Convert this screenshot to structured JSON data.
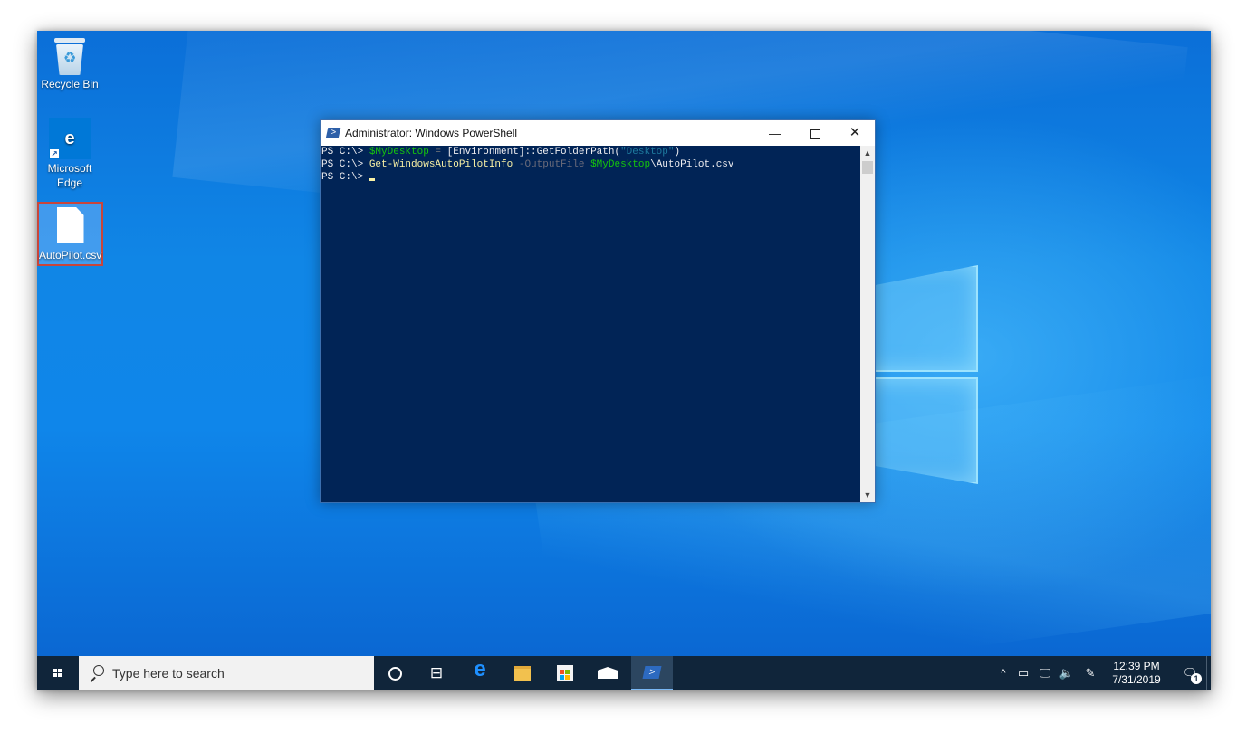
{
  "desktop": {
    "icons": [
      {
        "label": "Recycle Bin",
        "icon": "recycle-bin-icon"
      },
      {
        "label": "Microsoft Edge",
        "icon": "edge-icon"
      },
      {
        "label": "AutoPilot.csv",
        "icon": "csv-file-icon",
        "selected": true
      }
    ]
  },
  "window": {
    "title": "Administrator: Windows PowerShell",
    "icon": "powershell-icon",
    "controls": {
      "minimize": "—",
      "close": "✕"
    },
    "console": {
      "line1": {
        "prompt": "PS C:\\> ",
        "var": "$MyDesktop",
        "op": " = ",
        "class": "[Environment]::GetFolderPath(",
        "str": "\"Desktop\"",
        "close": ")"
      },
      "line2": {
        "prompt": "PS C:\\> ",
        "cmd": "Get-WindowsAutoPilotInfo",
        "param": " -OutputFile ",
        "var": "$MyDesktop",
        "path": "\\AutoPilot.csv"
      },
      "line3": {
        "prompt": "PS C:\\> "
      }
    },
    "scroll": {
      "up": "▲",
      "down": "▼"
    },
    "colors": {
      "background": "#012456",
      "variable": "#16c60c",
      "command": "#f9f1a5"
    }
  },
  "taskbar": {
    "search_placeholder": "Type here to search",
    "apps": [
      "cortana-icon",
      "task-view-icon",
      "edge-icon",
      "file-explorer-icon",
      "store-icon",
      "mail-icon",
      "powershell-icon"
    ],
    "tray": {
      "chevron": "^",
      "time": "12:39 PM",
      "date": "7/31/2019",
      "notification_count": "1"
    }
  }
}
